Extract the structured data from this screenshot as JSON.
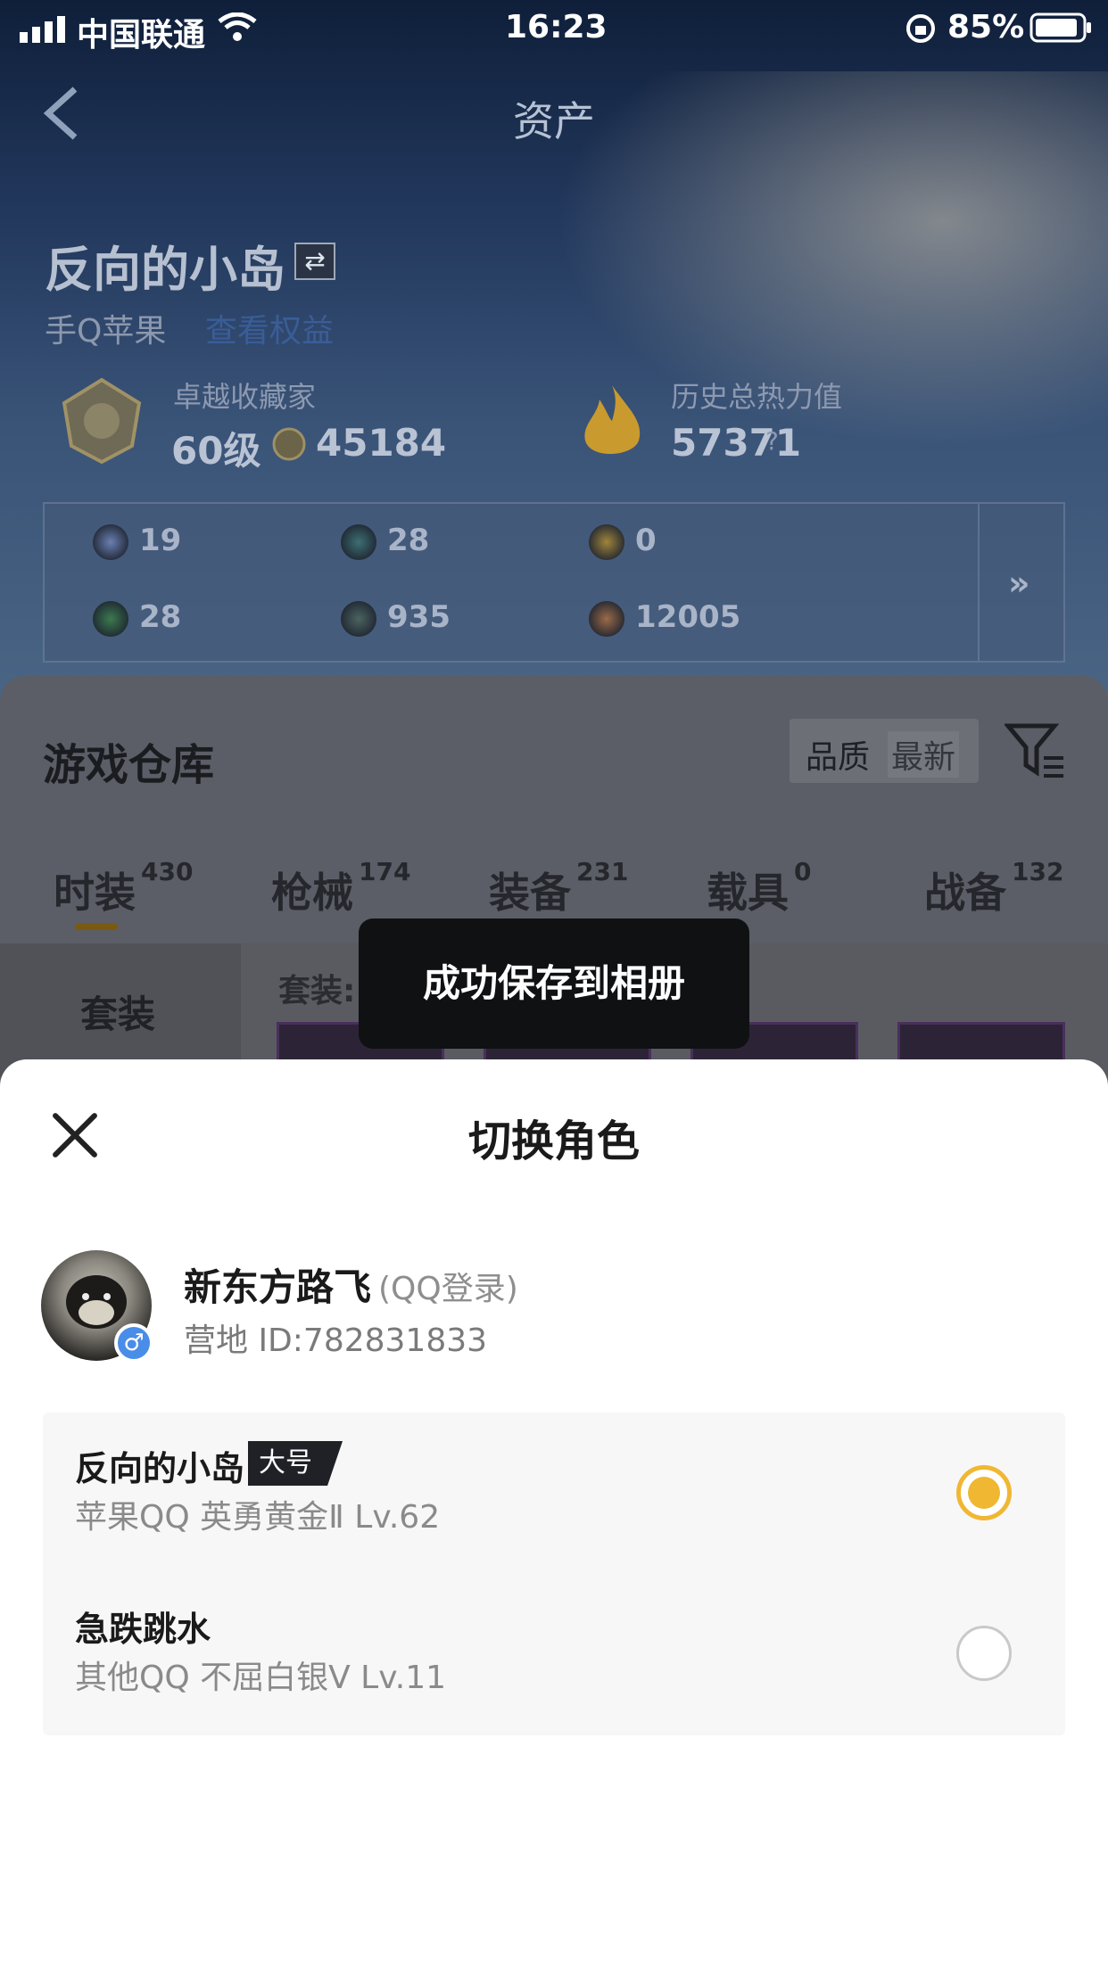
{
  "status_bar": {
    "carrier": "中国联通",
    "time": "16:23",
    "battery": "85%"
  },
  "header": {
    "title": "资产",
    "back_icon": "chevron-left-icon"
  },
  "profile": {
    "name": "反向的小岛",
    "platform": "手Q苹果",
    "platform_link": "查看权益",
    "collector_label": "卓越收藏家",
    "level": "60级",
    "coins": "45184",
    "heat_label": "历史总热力值",
    "heat_value": "57371",
    "heat_help": "?"
  },
  "stats": [
    {
      "value": "19",
      "color": "#6a7fb2"
    },
    {
      "value": "28",
      "color": "#3d6f73"
    },
    {
      "value": "0",
      "color": "#a0843b"
    },
    {
      "value": "28",
      "color": "#3c7a4f"
    },
    {
      "value": "935",
      "color": "#4c6460"
    },
    {
      "value": "12005",
      "color": "#9a6a48"
    }
  ],
  "stats_more": "»",
  "warehouse": {
    "title": "游戏仓库",
    "sort_quality": "品质",
    "sort_latest": "最新",
    "tabs": [
      {
        "label": "时装",
        "count": "430"
      },
      {
        "label": "枪械",
        "count": "174"
      },
      {
        "label": "装备",
        "count": "231"
      },
      {
        "label": "载具",
        "count": "0"
      },
      {
        "label": "战备",
        "count": "132"
      }
    ],
    "side_item": "套装",
    "suits_label": "套装:"
  },
  "toast": "成功保存到相册",
  "sheet": {
    "title": "切换角色",
    "user_name": "新东方路飞",
    "login": "(QQ登录)",
    "camp_id": "营地 ID:782831833",
    "gender_icon": "♂",
    "roles": [
      {
        "name": "反向的小岛",
        "tag": "大号",
        "info": "苹果QQ  英勇黄金Ⅱ  Lv.62",
        "selected": true
      },
      {
        "name": "急跌跳水",
        "info": "其他QQ  不屈白银Ⅴ  Lv.11",
        "selected": false
      }
    ]
  },
  "colors": {
    "accent": "#f0b733",
    "dim_panel": "#5b5e66"
  }
}
